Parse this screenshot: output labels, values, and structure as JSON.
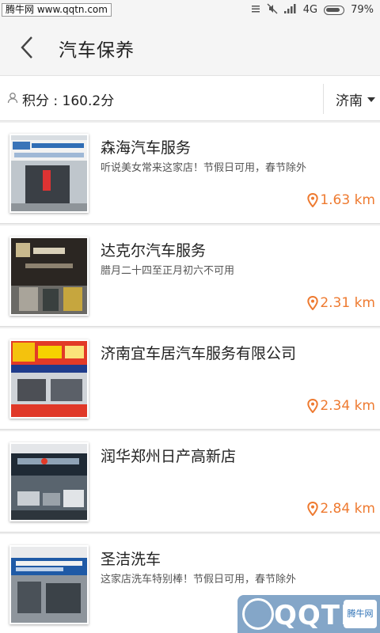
{
  "status_bar": {
    "watermark": "腾牛网 www.qqtn.com",
    "network": "4G",
    "battery": "79%"
  },
  "header": {
    "title": "汽车保养"
  },
  "filter": {
    "points_label": "积分 : 160.2分",
    "city": "济南"
  },
  "shops": [
    {
      "name": "森海汽车服务",
      "desc": "听说美女常来这家店！节假日可用，春节除外",
      "distance": "1.63 km"
    },
    {
      "name": "达克尔汽车服务",
      "desc": "腊月二十四至正月初六不可用",
      "distance": "2.31 km"
    },
    {
      "name": "济南宜车居汽车服务有限公司",
      "desc": "",
      "distance": "2.34 km"
    },
    {
      "name": "润华郑州日产高新店",
      "desc": "",
      "distance": "2.84 km"
    },
    {
      "name": "圣洁洗车",
      "desc": "这家店洗车特别棒！节假日可用，春节除外",
      "distance": ""
    }
  ],
  "watermark_br": {
    "text": "QQTN",
    "tag": "腾牛网"
  },
  "colors": {
    "accent": "#ee7a30",
    "background": "#eeeeee"
  }
}
